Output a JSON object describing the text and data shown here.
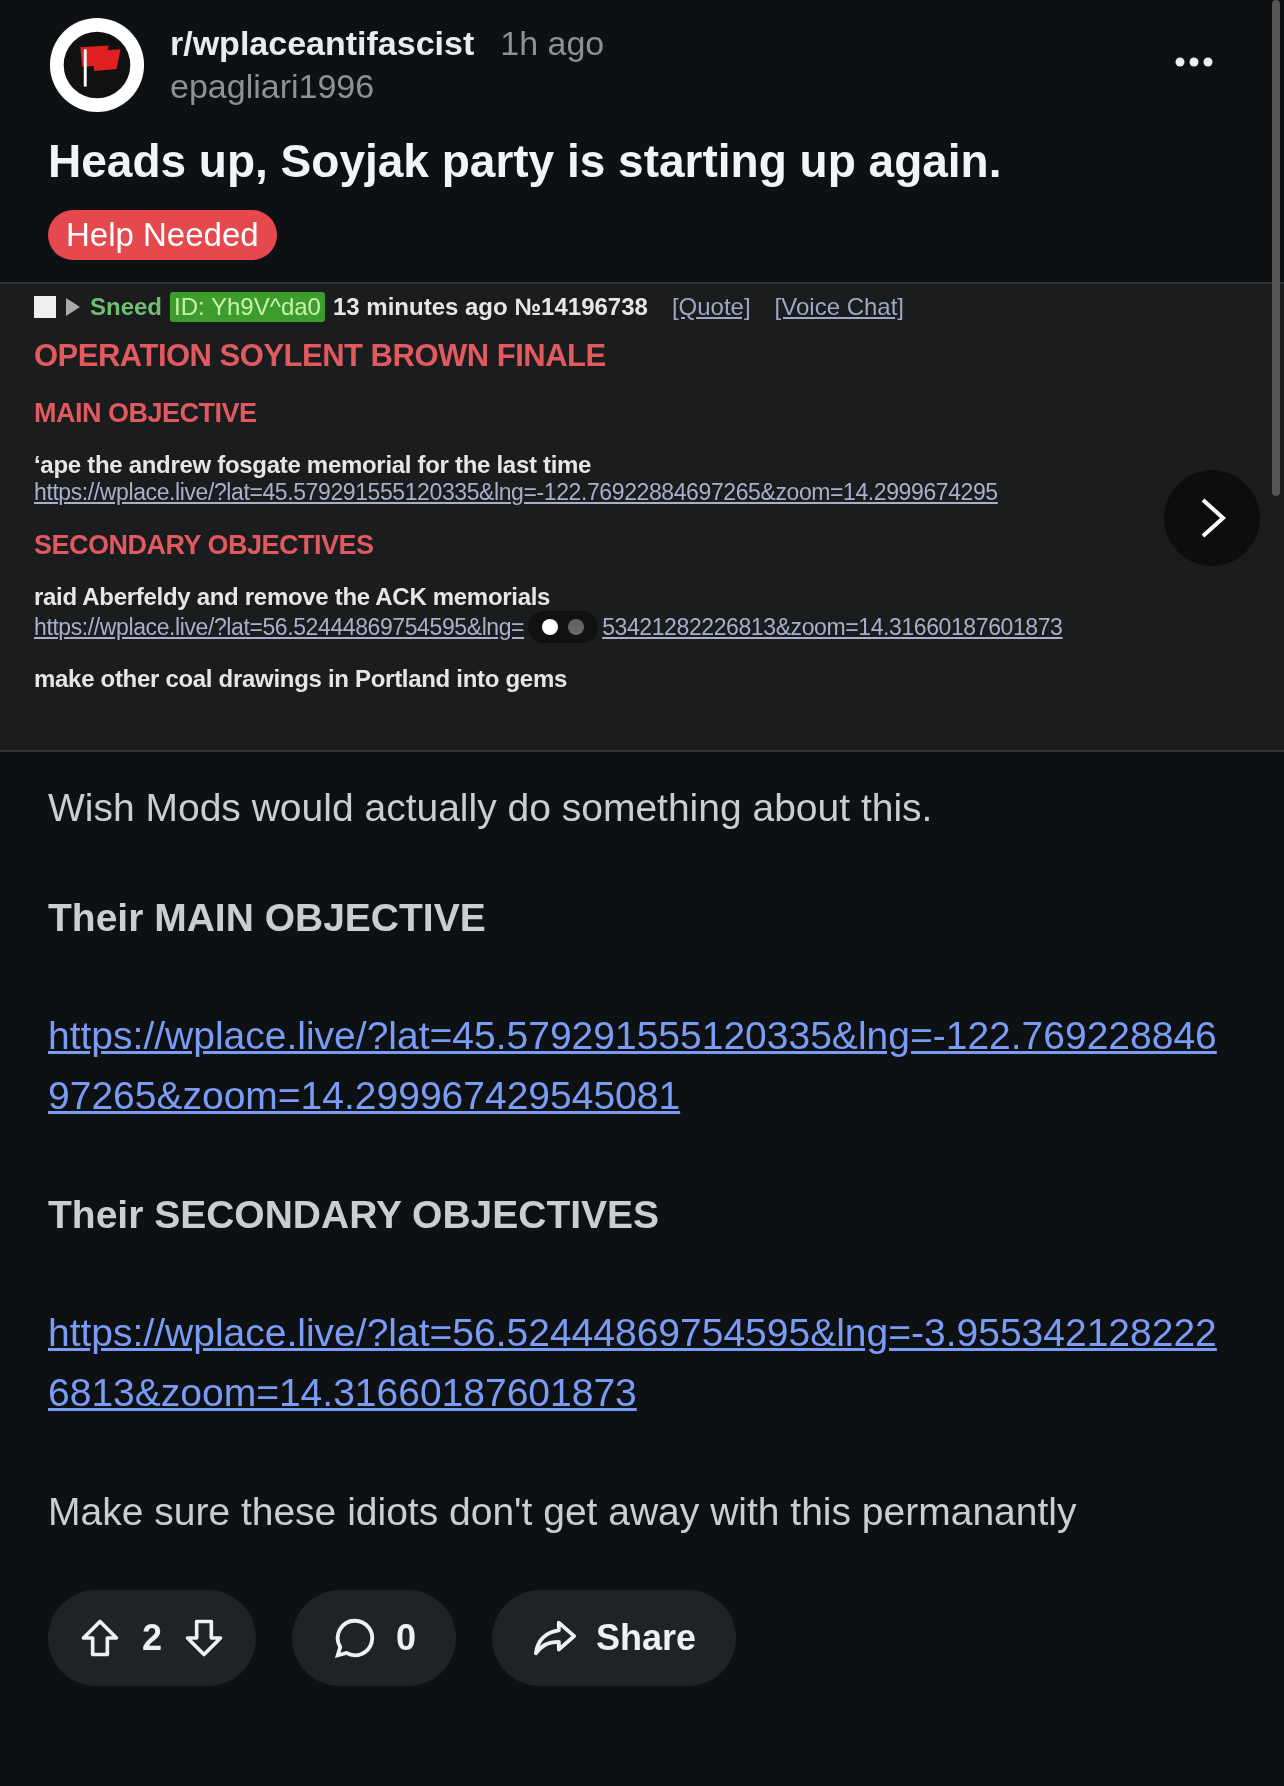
{
  "post": {
    "subreddit": "r/wplaceantifascist",
    "time": "1h ago",
    "author": "epagliari1996",
    "title": "Heads up, Soyjak party is starting up again.",
    "flair": "Help Needed"
  },
  "screenshot": {
    "meta": {
      "name": "Sneed",
      "id": "ID: Yh9V^da0",
      "time": "13 minutes ago №14196738",
      "links": [
        "[Quote]",
        "[Voice Chat]"
      ]
    },
    "checkbox": {
      "checked": false
    },
    "blocks": [
      {
        "kind": "title",
        "text": "OPERATION SOYLENT BROWN FINALE"
      },
      {
        "kind": "heading",
        "text": "MAIN OBJECTIVE"
      },
      {
        "kind": "text",
        "text": "‘ape the andrew fosgate memorial for the last time"
      },
      {
        "kind": "link",
        "text": "https://wplace.live/?lat=45.579291555120335&lng=-122.76922884697265&zoom=14.2999674295"
      },
      {
        "kind": "heading",
        "text": "SECONDARY OBJECTIVES"
      },
      {
        "kind": "text",
        "text": "raid Aberfeldy and remove the ACK memorials"
      },
      {
        "kind": "split_link",
        "parts": [
          "https://wplace.live/?lat=56.52444869754595&lng=",
          "53421282226813&zoom=14.31660187601873"
        ]
      },
      {
        "kind": "text",
        "text": "make other coal drawings in Portland into gems"
      }
    ],
    "pager": [
      {
        "selected": true
      },
      {
        "selected": false
      }
    ]
  },
  "body": [
    {
      "kind": "text",
      "text": "Wish Mods would actually do something about this."
    },
    {
      "kind": "bold",
      "text": "Their MAIN OBJECTIVE"
    },
    {
      "kind": "link",
      "text": "https://wplace.live/?lat=45.579291555120335&lng=-122.76922884697265&zoom=14.299967429545081"
    },
    {
      "kind": "bold",
      "text": "Their SECONDARY OBJECTIVES"
    },
    {
      "kind": "link",
      "text": "https://wplace.live/?lat=56.52444869754595&lng=-3.9553421282226813&zoom=14.31660187601873"
    },
    {
      "kind": "text",
      "text": "Make sure these idiots don't get away with this permanantly"
    }
  ],
  "actions": {
    "votes": "2",
    "comments": "0",
    "share": "Share"
  }
}
